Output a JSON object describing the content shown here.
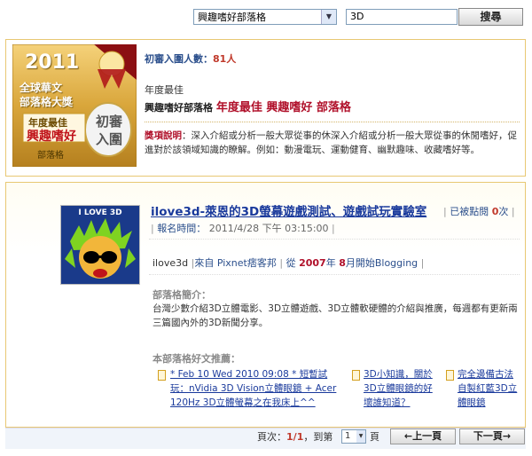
{
  "search": {
    "category_selected": "興趣嗜好部落格",
    "query_value": "3D",
    "button_label": "搜尋"
  },
  "award": {
    "badge": {
      "year": "2011",
      "line1": "全球華文",
      "line2": "部落格大獎",
      "category": "年度最佳",
      "name": "興趣嗜好",
      "suffix": "部落格",
      "seal_line1": "初審",
      "seal_line2": "入圍"
    },
    "count_label": "初審入圍人數：",
    "count_value": "81人",
    "year_label": "年度最佳",
    "category_small": "興趣嗜好部落格",
    "category_big": "年度最佳 興趣嗜好 部落格",
    "desc_label": "獎項說明",
    "desc_text": "：深入介紹或分析一般大眾從事的休深入介紹或分析一般大眾從事的休閒嗜好，促進對於該領域知識的瞭解。例如：動漫電玩、運動健育、幽默趣味、收藏嗜好等。"
  },
  "blog": {
    "thumb_text": "I LOVE 3D",
    "title": "ilove3d-萊恩的3D螢幕遊戲測試、遊戲試玩實驗室",
    "hits_label": "已被點閱",
    "hits_value": "0",
    "hits_unit": "次",
    "reg_label": "報名時間：",
    "reg_time": "2011/4/28 下午 03:15:00",
    "author": "ilove3d",
    "from_label": "來自",
    "platform": "Pixnet痞客邦",
    "since_prefix": "從",
    "since_year": "2007",
    "since_year_unit": "年",
    "since_month": "8",
    "since_suffix": "月開始Blogging",
    "intro_heading": "部落格簡介：",
    "intro_text": "台灣少數介紹3D立體電影、3D立體遊戲、3D立體軟硬體的介紹與推廣，每週都有更新兩三篇國內外的3D新聞分享。",
    "rec_heading": "本部落格好文推薦：",
    "recs": [
      {
        "text": "* Feb 10 Wed 2010 09:08 * 短暫試玩：nVidia 3D Vision立體眼鏡 + Acer 120Hz 3D立體螢幕之在我床上^^"
      },
      {
        "text": "3D小知識，關於3D立體眼鏡的好壞誰知道？"
      },
      {
        "text": "完全邊備古法 自製紅藍3D立體眼鏡"
      }
    ]
  },
  "pager": {
    "page_label": "頁次：",
    "page_current": "1",
    "page_sep": "/",
    "page_total": "1",
    "goto_label": "，到第",
    "goto_value": "1",
    "goto_unit": "頁",
    "prev_label": "←上一頁",
    "next_label": "下一頁→"
  },
  "colors": {
    "accent_red": "#b0102a",
    "link_blue": "#1a3a9c",
    "gold_border": "#e8c873"
  }
}
